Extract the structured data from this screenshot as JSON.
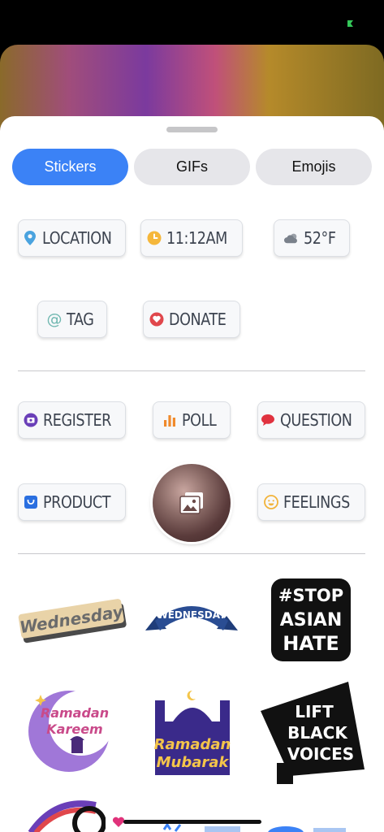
{
  "tabs": [
    {
      "label": "Stickers",
      "active": true
    },
    {
      "label": "GIFs",
      "active": false
    },
    {
      "label": "Emojis",
      "active": false
    }
  ],
  "chips": {
    "location": {
      "label": "LOCATION",
      "icon": "location-pin-icon"
    },
    "time": {
      "label": "11:12AM",
      "icon": "clock-icon"
    },
    "weather": {
      "label": "52°F",
      "icon": "cloudy-icon"
    },
    "tag": {
      "label": "TAG",
      "icon": "at-sign-icon"
    },
    "donate": {
      "label": "DONATE",
      "icon": "donate-icon"
    },
    "register": {
      "label": "REGISTER",
      "icon": "register-icon"
    },
    "poll": {
      "label": "POLL",
      "icon": "bar-chart-icon"
    },
    "question": {
      "label": "QUESTION",
      "icon": "speech-bubble-icon"
    },
    "product": {
      "label": "PRODUCT",
      "icon": "shopping-bag-icon"
    },
    "feelings": {
      "label": "FEELINGS",
      "icon": "smiley-icon"
    }
  },
  "stickers": {
    "wednesday_retro": "Wednesday",
    "wednesday_banner": "WEDNESDAY",
    "stop_asian_hate": [
      "#STOP",
      "ASIAN",
      "HATE"
    ],
    "ramadan_kareem": [
      "Ramadan",
      "Kareem"
    ],
    "ramadan_mubarak": [
      "Ramadan",
      "Mubarak"
    ],
    "lift_black_voices": [
      "LIFT",
      "BLACK",
      "VOICES"
    ]
  },
  "colors": {
    "accent": "#3b82f6",
    "tab_inactive": "#e6e6ea",
    "chip_text": "#3d4450",
    "chip_border": "#dcdfe4",
    "status_green": "#34c759"
  }
}
